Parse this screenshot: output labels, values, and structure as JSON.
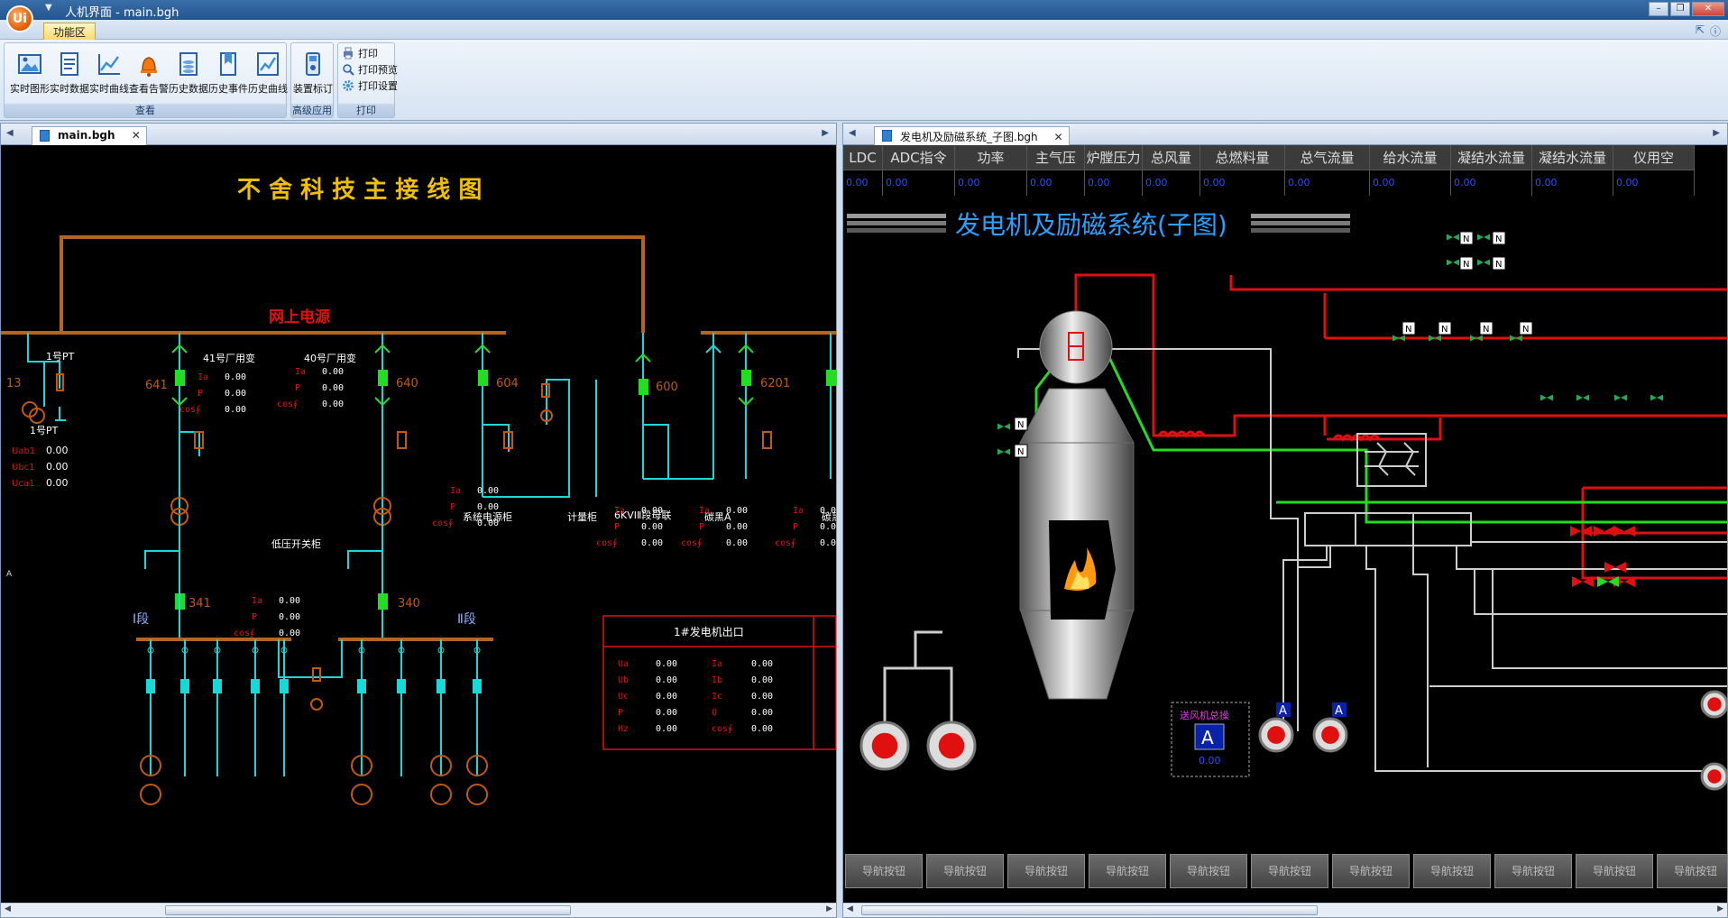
{
  "window": {
    "title": "人机界面 - main.bgh",
    "logo_text": "Ui"
  },
  "ribbon": {
    "tab": "功能区",
    "groups": [
      {
        "label": "查看",
        "buttons": [
          "实时图形",
          "实时数据",
          "实时曲线",
          "查看告警",
          "历史数据",
          "历史事件",
          "历史曲线"
        ]
      },
      {
        "label": "高级应用",
        "buttons": [
          "装置标订"
        ]
      },
      {
        "label": "打印",
        "buttons": [
          "打印",
          "打印预览",
          "打印设置"
        ]
      }
    ]
  },
  "left_pane": {
    "tab": "main.bgh",
    "title": "不 舍 科 技 主 接 线 图",
    "grid_label": "网上电源",
    "texts": {
      "pt1": "1号PT",
      "pt1b": "1号PT",
      "n13": "13",
      "uab": "Uab1",
      "ubc": "Ubc1",
      "uca": "Uca1",
      "zero": "0.00",
      "t41": "41号厂用变",
      "t40": "40号厂用变",
      "n641": "641",
      "n640": "640",
      "n604": "604",
      "n600": "600",
      "n6201": "6201",
      "n341": "341",
      "n340": "340",
      "ia": "Ia",
      "p": "P",
      "cos": "cos∮",
      "lowv": "低压开关柜",
      "sys": "系统电源柜",
      "meter": "计量柜",
      "tie": "6KVⅠⅡ段母联",
      "carbon": "碳黑A",
      "carbon2": "碳黑",
      "seg1": "Ⅰ段",
      "seg2": "Ⅱ段",
      "gen_out": "1#发电机出口",
      "ua": "Ua",
      "ub": "Ub",
      "uc": "Uc",
      "hz": "Hz",
      "ib": "Ib",
      "ic": "Ic",
      "q": "Q"
    }
  },
  "right_pane": {
    "tab": "发电机及励磁系统_子图.bgh",
    "title": "发电机及励磁系统(子图)",
    "columns": [
      "LDC",
      "ADC指令",
      "功率",
      "主气压",
      "炉膛压力",
      "总风量",
      "总燃料量",
      "总气流量",
      "给水流量",
      "凝结水流量",
      "凝结水流量",
      "仪用空"
    ],
    "values": [
      "0.00",
      "0.00",
      "0.00",
      "0.00",
      "0.00",
      "0.00",
      "0.00",
      "0.00",
      "0.00",
      "0.00",
      "0.00",
      "0.00"
    ],
    "fan_box": {
      "label": "送风机总操",
      "letter": "A",
      "value": "0.00"
    },
    "n_label": "N",
    "a_label": "A",
    "nav_buttons": [
      "导航按钮",
      "导航按钮",
      "导航按钮",
      "导航按钮",
      "导航按钮",
      "导航按钮",
      "导航按钮",
      "导航按钮",
      "导航按钮",
      "导航按钮",
      "导航按钮"
    ]
  },
  "colors": {
    "bus": "#b5651d",
    "cyan": "#18d8d8",
    "green": "#22dd22",
    "red": "#e01010",
    "yellow": "#f0c000",
    "brown": "#c05a10"
  }
}
